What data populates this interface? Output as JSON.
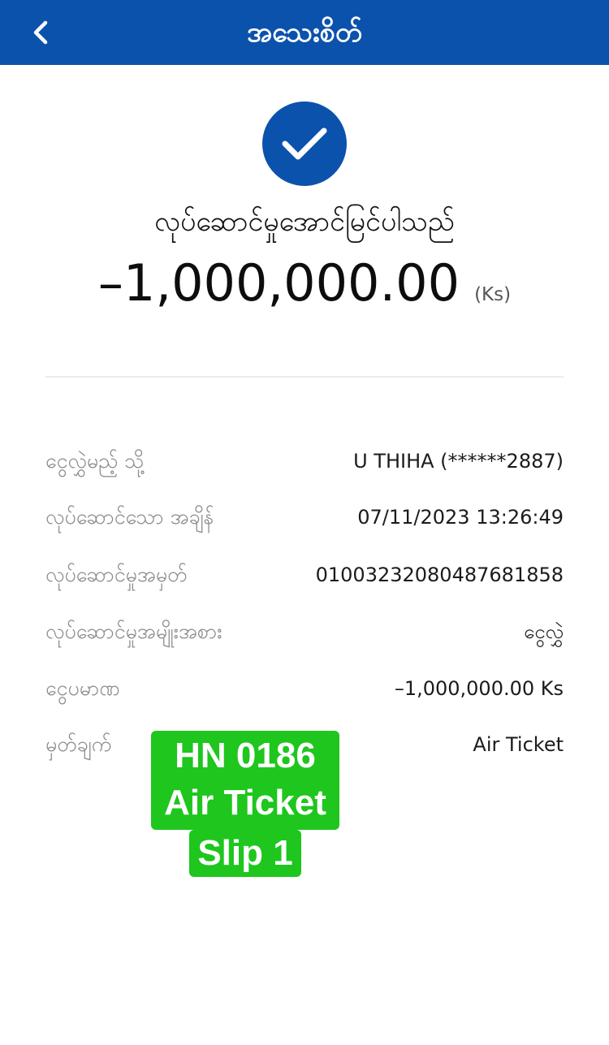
{
  "header": {
    "title": "အသေးစိတ်",
    "back_icon": "chevron-left-icon",
    "bg_color": "#0b52ad"
  },
  "status": {
    "icon": "check-circle-icon",
    "text": "လုပ်ဆောင်မှုအောင်မြင်ပါသည်",
    "amount": "–1,000,000.00",
    "unit": "(Ks)"
  },
  "details": [
    {
      "label": "ငွေလွှဲမည့် သို့",
      "value": "U THIHA (******2887)"
    },
    {
      "label": "လုပ်ဆောင်သော အချိန်",
      "value": "07/11/2023 13:26:49"
    },
    {
      "label": "လုပ်ဆောင်မှုအမှတ်",
      "value": "01003232080487681858"
    },
    {
      "label": "လုပ်ဆောင်မှုအမျိုးအစား",
      "value": "ငွေလွှဲ"
    },
    {
      "label": "ငွေပမာဏ",
      "value": "–1,000,000.00 Ks"
    },
    {
      "label": "မှတ်ချက်",
      "value": "Air Ticket"
    }
  ],
  "sticker": {
    "line1": "HN 0186",
    "line2": "Air Ticket",
    "line3": "Slip 1",
    "color": "#1ec61e"
  }
}
